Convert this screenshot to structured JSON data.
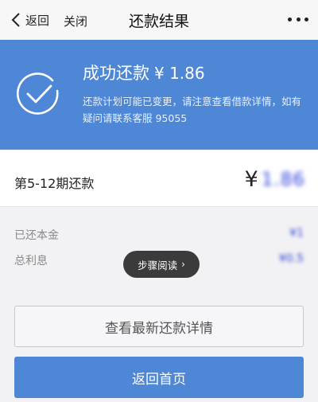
{
  "navbar": {
    "back_label": "返回",
    "close_label": "关闭",
    "title": "还款结果",
    "more_icon": "more-dots-icon"
  },
  "banner": {
    "title_prefix": "成功还款",
    "title_amount": "¥ 1.86",
    "description": "还款计划可能已变更，请注意查看借款详情，如有疑问请联系客服 95055",
    "icon": "check-circle-icon",
    "background": "#4f87d7"
  },
  "period": {
    "label": "第5-12期还款",
    "currency": "¥",
    "amount_redacted": "1.86"
  },
  "details": {
    "principal_label": "已还本金",
    "principal_value": "¥1",
    "interest_label": "总利息",
    "interest_value": "¥0.5"
  },
  "toast": {
    "text": "步骤阅读",
    "arrow": "›"
  },
  "buttons": {
    "view_details": "查看最新还款详情",
    "back_home": "返回首页"
  },
  "colors": {
    "accent": "#4f87d7",
    "background": "#f2f2f4",
    "redaction": "#2a3fd8"
  }
}
